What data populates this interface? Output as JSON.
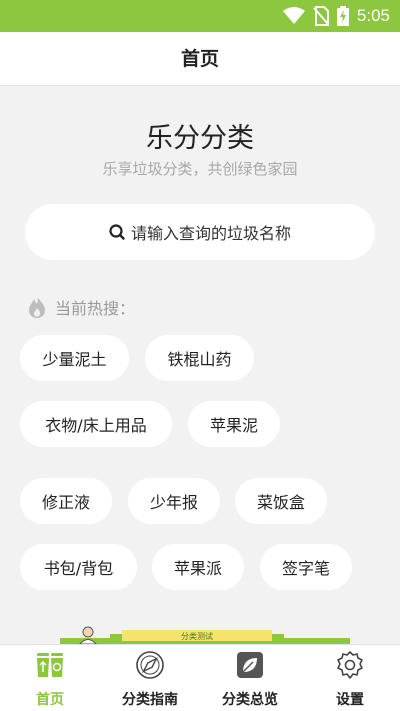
{
  "status_bar": {
    "time": "5:05"
  },
  "header": {
    "title": "首页"
  },
  "main": {
    "app_title": "乐分分类",
    "app_subtitle": "乐享垃圾分类，共创绿色家园",
    "search_placeholder": "请输入查询的垃圾名称",
    "hot_label": "当前热搜："
  },
  "hot_searches": [
    "少量泥土",
    "铁棍山药",
    "衣物/床上用品",
    "苹果泥",
    "修正液",
    "少年报",
    "菜饭盒",
    "书包/背包",
    "苹果派",
    "签字笔"
  ],
  "banner": {
    "text": "分类测试"
  },
  "nav": [
    {
      "label": "首页",
      "icon": "recycle-bins-icon",
      "active": true
    },
    {
      "label": "分类指南",
      "icon": "compass-icon",
      "active": false
    },
    {
      "label": "分类总览",
      "icon": "leaf-icon",
      "active": false
    },
    {
      "label": "设置",
      "icon": "gear-icon",
      "active": false
    }
  ],
  "colors": {
    "accent": "#8dc63f",
    "background": "#f2f2f2",
    "chip": "#ffffff",
    "subtitle": "#a8a8a8"
  }
}
